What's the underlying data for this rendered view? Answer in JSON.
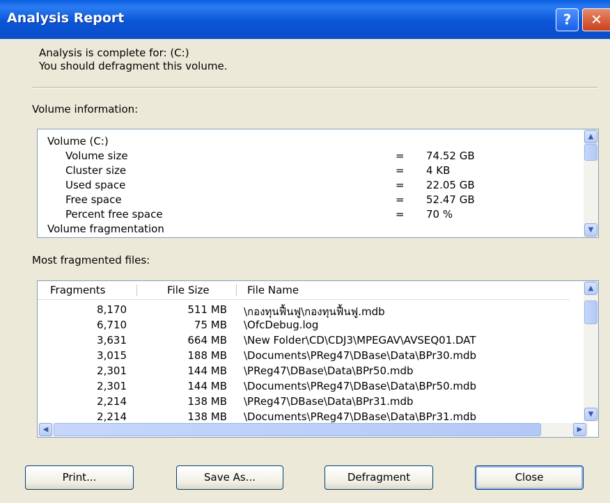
{
  "window": {
    "title": "Analysis Report",
    "help_glyph": "?",
    "close_glyph": "✕"
  },
  "summary": {
    "line1": "Analysis is complete for: (C:)",
    "line2": "You should defragment this volume."
  },
  "volume_info": {
    "label": "Volume information:",
    "rows": [
      {
        "name": "Volume  (C:)",
        "eq": "",
        "value": "",
        "indent": 0
      },
      {
        "name": "Volume size",
        "eq": "=",
        "value": "74.52 GB",
        "indent": 1
      },
      {
        "name": "Cluster size",
        "eq": "=",
        "value": "4 KB",
        "indent": 1
      },
      {
        "name": "Used space",
        "eq": "=",
        "value": "22.05 GB",
        "indent": 1
      },
      {
        "name": "Free space",
        "eq": "=",
        "value": "52.47 GB",
        "indent": 1
      },
      {
        "name": "Percent free space",
        "eq": "=",
        "value": "70 %",
        "indent": 1
      },
      {
        "name": "Volume fragmentation",
        "eq": "",
        "value": "",
        "indent": 0
      }
    ]
  },
  "fragmented_files": {
    "label": "Most fragmented files:",
    "columns": [
      "Fragments",
      "File Size",
      "File Name"
    ],
    "rows": [
      {
        "fragments": "8,170",
        "size": "511 MB",
        "name": "\\กองทุนฟื้นฟู\\กองทุนฟื้นฟู.mdb"
      },
      {
        "fragments": "6,710",
        "size": "75 MB",
        "name": "\\OfcDebug.log"
      },
      {
        "fragments": "3,631",
        "size": "664 MB",
        "name": "\\New Folder\\CD\\CDJ3\\MPEGAV\\AVSEQ01.DAT"
      },
      {
        "fragments": "3,015",
        "size": "188 MB",
        "name": "\\Documents\\PReg47\\DBase\\Data\\BPr30.mdb"
      },
      {
        "fragments": "2,301",
        "size": "144 MB",
        "name": "\\PReg47\\DBase\\Data\\BPr50.mdb"
      },
      {
        "fragments": "2,301",
        "size": "144 MB",
        "name": "\\Documents\\PReg47\\DBase\\Data\\BPr50.mdb"
      },
      {
        "fragments": "2,214",
        "size": "138 MB",
        "name": "\\PReg47\\DBase\\Data\\BPr31.mdb"
      },
      {
        "fragments": "2,214",
        "size": "138 MB",
        "name": "\\Documents\\PReg47\\DBase\\Data\\BPr31.mdb"
      }
    ]
  },
  "buttons": {
    "print": "Print...",
    "save_as": "Save As...",
    "defragment": "Defragment",
    "close": "Close"
  },
  "icons": {
    "scroll_up": "▲",
    "scroll_down": "▼",
    "scroll_left": "◀",
    "scroll_right": "▶"
  }
}
